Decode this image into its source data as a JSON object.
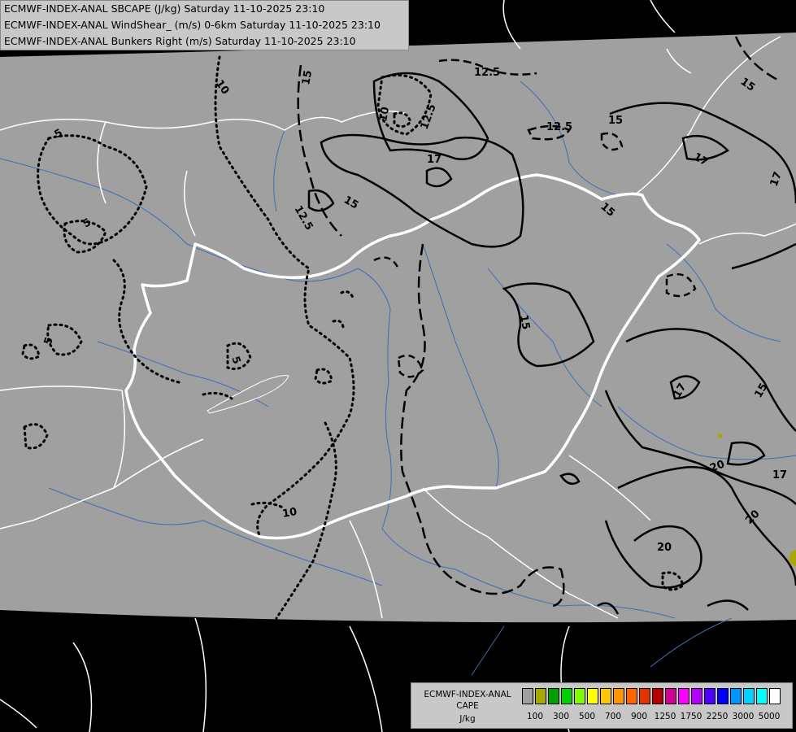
{
  "header": {
    "line1": "ECMWF-INDEX-ANAL SBCAPE (J/kg) Saturday 11-10-2025 23:10",
    "line2": "ECMWF-INDEX-ANAL WindShear_ (m/s) 0-6km Saturday 11-10-2025 23:10",
    "line3": "ECMWF-INDEX-ANAL Bunkers Right (m/s) Saturday 11-10-2025 23:10"
  },
  "legend": {
    "title1": "ECMWF-INDEX-ANAL",
    "title2": "CAPE",
    "title3": "J/kg",
    "colors": [
      "#a0a0a0",
      "#a8a800",
      "#00a000",
      "#00d000",
      "#80ff00",
      "#ffff00",
      "#ffc800",
      "#ff9600",
      "#ff6400",
      "#e63200",
      "#b40000",
      "#d20096",
      "#ff00ff",
      "#b400ff",
      "#5000ff",
      "#0000ff",
      "#0096ff",
      "#00d2ff",
      "#00ffff",
      "#ffffff"
    ],
    "ticks": [
      "100",
      "300",
      "500",
      "700",
      "900",
      "1250",
      "1750",
      "2250",
      "3000",
      "5000"
    ]
  },
  "contour_labels": {
    "windshear": [
      "10",
      "12.5",
      "15",
      "17",
      "20",
      "12.5",
      "15",
      "17",
      "20",
      "12.5",
      "15",
      "20",
      "20"
    ],
    "bunkers": [
      "5",
      "5",
      "5",
      "10",
      "10",
      "10",
      "5"
    ]
  },
  "colors": {
    "background_domain": "#a0a0a0",
    "outside_domain": "#000000",
    "rivers": "#3e6fb4",
    "borders": "#ffffff",
    "contours": "#000000",
    "cape_patch": "#a8a800"
  }
}
